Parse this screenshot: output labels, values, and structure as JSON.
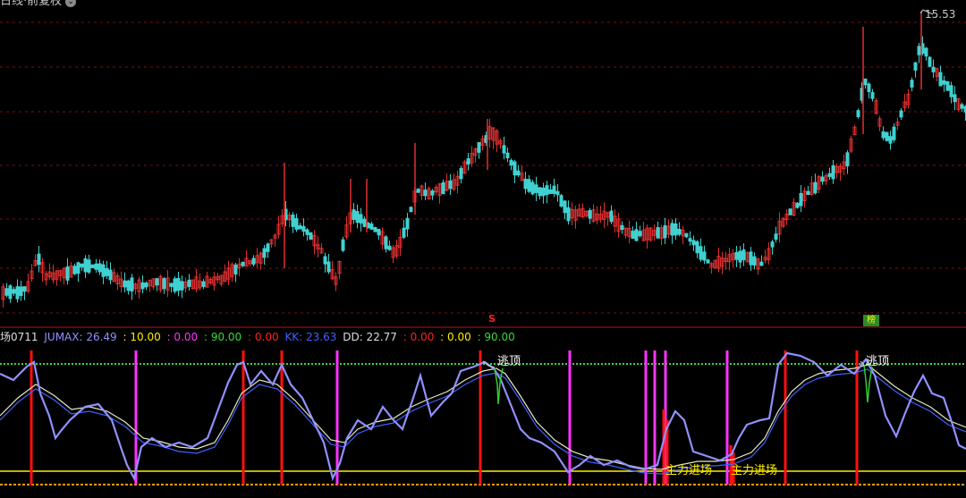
{
  "title": {
    "text": "日线·前复权",
    "dropdown_icon": "chevron-down-icon"
  },
  "price": {
    "max_label": "15.53"
  },
  "indicator": {
    "name": "场0711",
    "jumax_label": "JUMAX: 26.49",
    "jumax_params": [
      {
        "text": ": 10.00",
        "color": "#ffee00"
      },
      {
        "text": ": 0.00",
        "color": "#ff33ff"
      },
      {
        "text": ": 90.00",
        "color": "#33dd33"
      },
      {
        "text": ": 0.00",
        "color": "#ff2020"
      }
    ],
    "kk_label": "KK: 23.63",
    "dd_label": "DD: 22.77",
    "dd_params": [
      {
        "text": ": 0.00",
        "color": "#ff2020"
      },
      {
        "text": ": 0.00",
        "color": "#ffee00"
      },
      {
        "text": ": 90.00",
        "color": "#33dd33"
      }
    ]
  },
  "labels": {
    "top1": "逃顶",
    "top2": "逃顶",
    "entry1": "主力进场",
    "entry2": "主力进场",
    "signal_s": "S",
    "badge": "榜"
  },
  "colors": {
    "up": "#e03030",
    "down": "#40d0d0",
    "jumax": "#9090ff",
    "signal_red": "#ff1010",
    "signal_magenta": "#ff33ff",
    "level_green": "#33dd33",
    "level_yellow": "#ffee00",
    "kk": "#4060ff"
  }
}
